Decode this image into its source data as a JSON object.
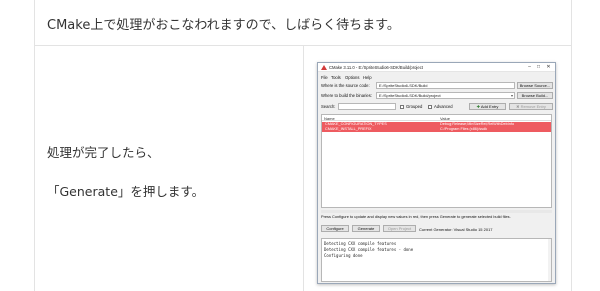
{
  "intro": "CMake上で処理がおこなわれますので、しばらく待ちます。",
  "left_text": {
    "line1": "処理が完了したら、",
    "line2": "「Generate」を押します。"
  },
  "window": {
    "title": "CMake 3.11.0 - E:/SpriteStudio6-SDK/Build/project",
    "buttons": {
      "minimize": "–",
      "maximize": "□",
      "close": "✕"
    },
    "menu": [
      "File",
      "Tools",
      "Options",
      "Help"
    ],
    "source_label": "Where is the source code:",
    "source_value": "E:/SpriteStudio6-SDK/Build",
    "browse_source": "Browse Source...",
    "build_label": "Where to build the binaries:",
    "build_value": "E:/SpriteStudio6-SDK/Build/project",
    "browse_build": "Browse Build...",
    "search_label": "Search:",
    "grouped_label": "Grouped",
    "advanced_label": "Advanced",
    "add_entry": "Add Entry",
    "remove_entry": "Remove Entry",
    "columns": {
      "name": "Name",
      "value": "Value"
    },
    "rows": [
      {
        "name": "CMAKE_CONFIGURATION_TYPES",
        "value": "Debug;Release;MinSizeRel;RelWithDebInfo"
      },
      {
        "name": "CMAKE_INSTALL_PREFIX",
        "value": "C:/Program Files (x86)/ssdk"
      }
    ],
    "hint": "Press Configure to update and display new values in red, then press Generate to generate selected build files.",
    "configure": "Configure",
    "generate": "Generate",
    "open_project": "Open Project",
    "generator_label": "Current Generator: Visual Studio 15 2017",
    "log": [
      "Detecting CXX compile features",
      "Detecting CXX compile features - done",
      "Configuring done"
    ]
  },
  "colors": {
    "row_highlight": "#ee5b60",
    "border": "#e3e3e3"
  }
}
